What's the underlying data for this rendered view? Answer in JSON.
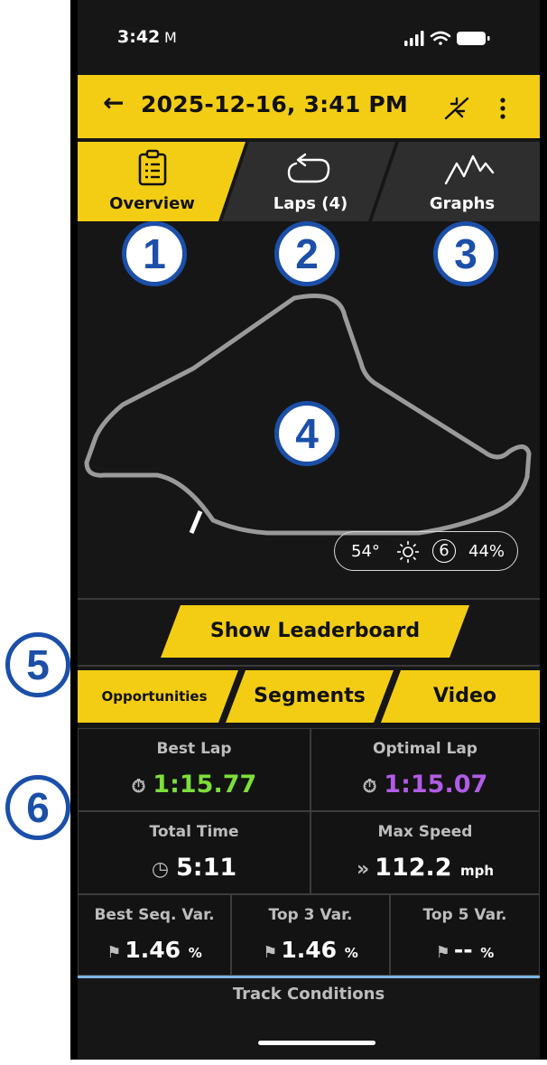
{
  "status": {
    "time": "3:42",
    "mail_icon": "M"
  },
  "header": {
    "title": "2025-12-16, 3:41 PM"
  },
  "tabs": [
    {
      "label": "Overview",
      "icon": "clipboard-icon"
    },
    {
      "label": "Laps (4)",
      "icon": "lap-loop-icon"
    },
    {
      "label": "Graphs",
      "icon": "graph-line-icon"
    }
  ],
  "callouts": [
    "1",
    "2",
    "3",
    "4",
    "5",
    "6"
  ],
  "weather": {
    "temp": "54°",
    "wind": "6",
    "humidity": "44%"
  },
  "leaderboard": {
    "label": "Show Leaderboard"
  },
  "subtabs": [
    "Opportunities",
    "Segments",
    "Video"
  ],
  "stats": {
    "best_lap": {
      "label": "Best Lap",
      "value": "1:15.77"
    },
    "optimal_lap": {
      "label": "Optimal Lap",
      "value": "1:15.07"
    },
    "total_time": {
      "label": "Total Time",
      "value": "5:11"
    },
    "max_speed": {
      "label": "Max Speed",
      "value": "112.2",
      "unit": "mph"
    },
    "best_seq": {
      "label": "Best Seq. Var.",
      "value": "1.46",
      "unit": "%"
    },
    "top3": {
      "label": "Top 3 Var.",
      "value": "1.46",
      "unit": "%"
    },
    "top5": {
      "label": "Top 5 Var.",
      "value": "--",
      "unit": "%"
    }
  },
  "track_conditions": {
    "label": "Track Conditions"
  },
  "colors": {
    "accent": "#f2cd14",
    "best": "#7dde3a",
    "optimal": "#b05ce6",
    "callout": "#1b4fa8"
  }
}
